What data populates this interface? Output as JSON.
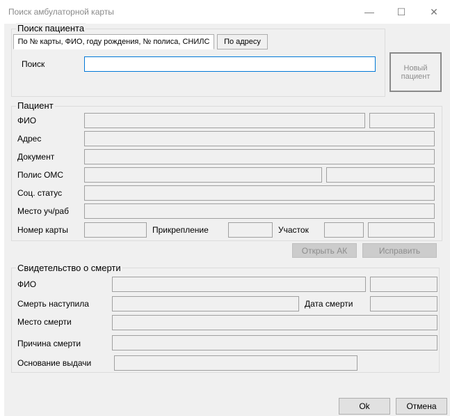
{
  "window": {
    "title": "Поиск амбулаторной карты",
    "controls": {
      "minimize": "—",
      "maximize": "☐",
      "close": "✕"
    }
  },
  "search_group": {
    "legend": "Поиск пациента",
    "tabs": [
      {
        "label": "По № карты, ФИО, году рождения, № полиса, СНИЛС",
        "active": true
      },
      {
        "label": "По адресу",
        "active": false
      }
    ],
    "search_label": "Поиск",
    "search_value": ""
  },
  "new_patient_button": "Новый пациент",
  "patient_group": {
    "legend": "Пациент",
    "fio_label": "ФИО",
    "address_label": "Адрес",
    "document_label": "Документ",
    "policy_label": "Полис ОМС",
    "social_status_label": "Соц. статус",
    "workplace_label": "Место уч/раб",
    "card_number_label": "Номер карты",
    "attachment_label": "Прикрепление",
    "district_label": "Участок"
  },
  "actions": {
    "open_ak": "Открыть АК",
    "fix": "Исправить"
  },
  "death_group": {
    "legend": "Свидетельство о смерти",
    "fio_label": "ФИО",
    "death_occurred_label": "Смерть наступила",
    "death_date_label": "Дата смерти",
    "death_place_label": "Место смерти",
    "death_cause_label": "Причина смерти",
    "issue_basis_label": "Основание выдачи"
  },
  "footer": {
    "ok": "Ok",
    "cancel": "Отмена"
  },
  "colors": {
    "window_bg": "#f0f0f0",
    "focus_border": "#0078d7",
    "disabled_text": "#8d8d8d"
  }
}
